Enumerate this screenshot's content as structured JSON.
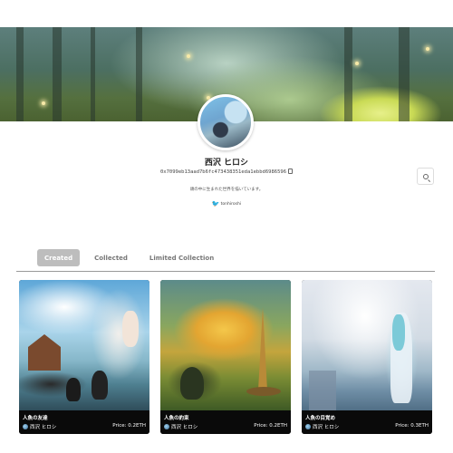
{
  "profile": {
    "name": "西沢 ヒロシ",
    "wallet": "0x7099eb13aad7b6fc473438351eda1ebbd6986596",
    "bio": "頭の中に生まれた世界を描いています。",
    "twitter": "tonhiroshi"
  },
  "icons": {
    "search": "search-icon",
    "copy": "copy-icon",
    "twitter": "twitter-icon"
  },
  "tabs": [
    {
      "label": "Created",
      "active": true
    },
    {
      "label": "Collected",
      "active": false
    },
    {
      "label": "Limited Collection",
      "active": false
    }
  ],
  "price_label": "Price:",
  "cards": [
    {
      "title": "人魚の友達",
      "owner": "西沢 ヒロシ",
      "price": "0.2ETH"
    },
    {
      "title": "人魚の約束",
      "owner": "西沢 ヒロシ",
      "price": "0.2ETH"
    },
    {
      "title": "人魚の目覚め",
      "owner": "西沢 ヒロシ",
      "price": "0.3ETH"
    }
  ],
  "colors": {
    "active_tab_bg": "#bdbdbd",
    "card_footer_bg": "#0a0a0a",
    "twitter_blue": "#1da1f2"
  }
}
